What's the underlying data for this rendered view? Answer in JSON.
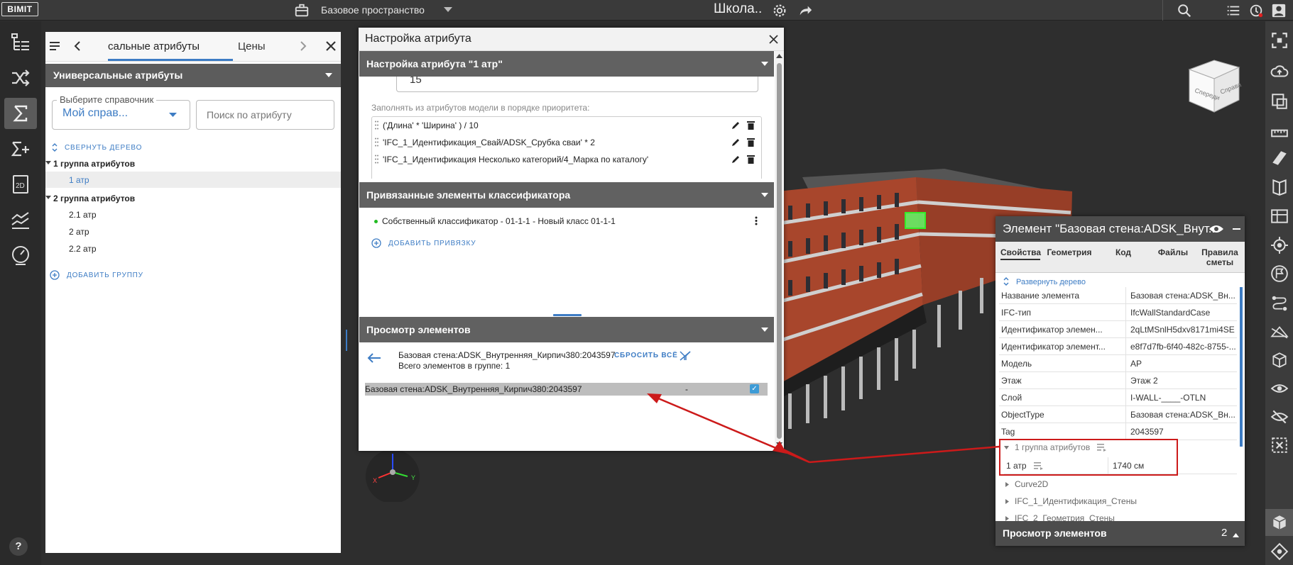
{
  "app": {
    "logo": "BIMIT",
    "workspace": "Базовое пространство",
    "project_title": "Школа.."
  },
  "left_panel": {
    "tabs": [
      "сальные атрибуты",
      "Цены"
    ],
    "section_title": "Универсальные атрибуты",
    "dict_label": "Выберите справочник",
    "dict_value": "Мой справ...",
    "search_placeholder": "Поиск по атрибуту",
    "collapse_tree": "СВЕРНУТЬ ДЕРЕВО",
    "groups": [
      {
        "label": "1 группа атрибутов",
        "items": [
          "1 атр"
        ]
      },
      {
        "label": "2 группа атрибутов",
        "items": [
          "2.1 атр",
          "2 атр",
          "2.2 атр"
        ]
      }
    ],
    "add_group": "ДОБАВИТЬ ГРУППУ"
  },
  "modal": {
    "title": "Настройка атрибута",
    "section1": "Настройка атрибута \"1 атр\"",
    "input_value": "15",
    "fill_hint": "Заполнять из атрибутов модели в порядке приоритета:",
    "rules": [
      "('Длина' * 'Ширина' ) / 10",
      "'IFC_1_Идентификация_Свай/ADSK_Срубка сваи' * 2",
      "'IFC_1_Идентификация Несколько категорий/4_Марка по каталогу'"
    ],
    "section2": "Привязанные элементы классификатора",
    "classifier_item": "Собственный классификатор - 01-1-1 - Новый класс 01-1-1",
    "add_binding": "ДОБАВИТЬ ПРИВЯЗКУ",
    "section3": "Просмотр элементов",
    "element_name": "Базовая стена:ADSK_Внутренняя_Кирпич380:2043597",
    "total_in_group": "Всего элементов в группе: 1",
    "reset_all": "СБРОСИТЬ ВСЁ",
    "row_name": "Базовая стена:ADSK_Внутренняя_Кирпич380:2043597",
    "row_value": "-"
  },
  "properties": {
    "title": "Элемент \"Базовая стена:ADSK_Внут...",
    "tabs": [
      "Свойства",
      "Геометрия",
      "Код",
      "Файлы",
      "Правила сметы"
    ],
    "expand_tree": "Развернуть дерево",
    "rows": [
      {
        "key": "Название элемента",
        "value": "Базовая стена:ADSK_Вн..."
      },
      {
        "key": "IFC-тип",
        "value": "IfcWallStandardCase"
      },
      {
        "key": "Идентификатор элемен...",
        "value": "2qLtMSnlH5dxv8171mi4SE"
      },
      {
        "key": "Идентификатор элемент...",
        "value": "e8f7d7fb-6f40-482c-8755-..."
      },
      {
        "key": "Модель",
        "value": "АР"
      },
      {
        "key": "Этаж",
        "value": "Этаж 2"
      },
      {
        "key": "Слой",
        "value": "I-WALL-____-OTLN"
      },
      {
        "key": "ObjectType",
        "value": "Базовая стена:ADSK_Вн..."
      },
      {
        "key": "Tag",
        "value": "2043597"
      }
    ],
    "group1": "1 группа атрибутов",
    "attr_key": "1 атр",
    "attr_value": "1740 см",
    "more_groups": [
      "Curve2D",
      "IFC_1_Идентификация_Стены",
      "IFC_2_Геометрия_Стены"
    ],
    "footer": "Просмотр элементов",
    "footer_count": "2"
  },
  "viewcube": {
    "front": "Спереди",
    "right": "Справа"
  },
  "colors": {
    "accent_blue": "#3d7cc4",
    "annotation_red": "#cc1a1a",
    "panel_header": "#616161",
    "toolbar": "#3a3a3a"
  }
}
